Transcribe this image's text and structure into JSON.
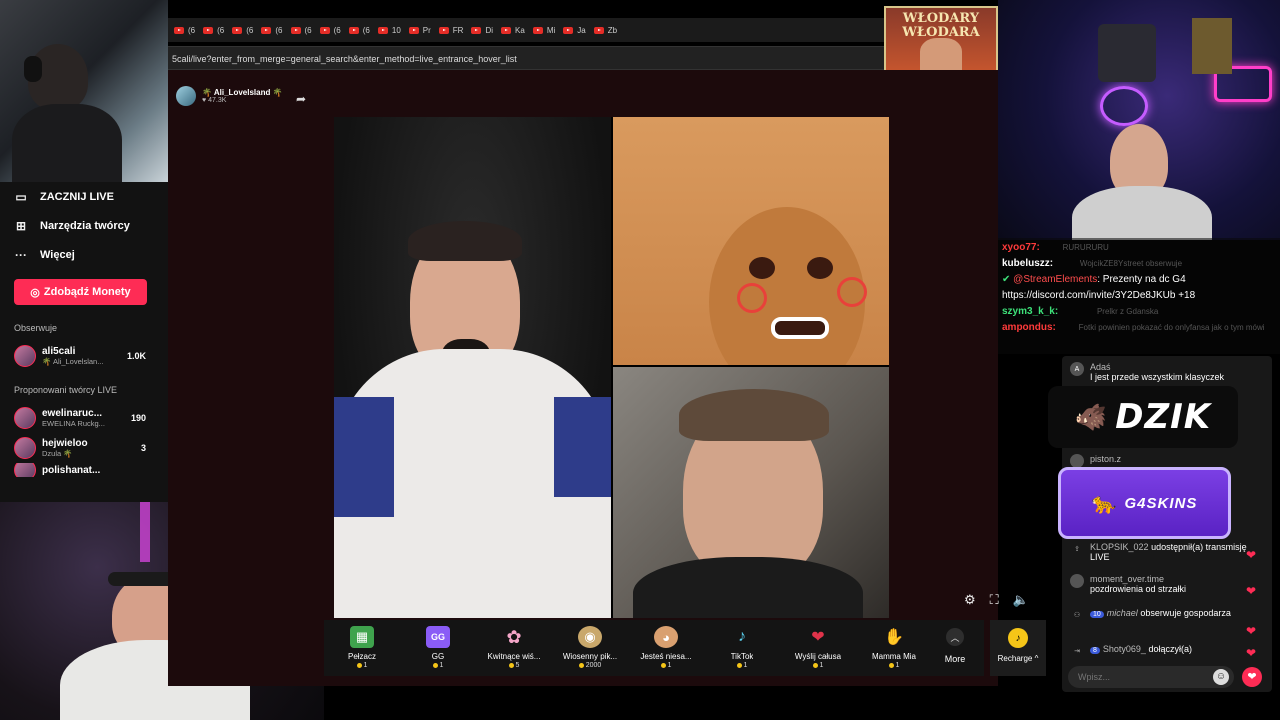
{
  "browser": {
    "tabs": [
      "(6",
      "(6",
      "(6",
      "(6",
      "(6",
      "(6",
      "(6",
      "10",
      "Pr",
      "FR",
      "Di",
      "Ka",
      "Mi",
      "Ja",
      "Zb"
    ],
    "address": "5cali/live?enter_from_merge=general_search&enter_method=live_entrance_hover_list",
    "banner_text": "WŁODARY WŁODARA"
  },
  "sidebar": {
    "menu": [
      {
        "icon": "video-icon",
        "glyph": "▭",
        "label": "ZACZNIJ LIVE"
      },
      {
        "icon": "tools-icon",
        "glyph": "⊞",
        "label": "Narzędzia twórcy"
      },
      {
        "icon": "more-icon",
        "glyph": "···",
        "label": "Więcej"
      }
    ],
    "coins_button": "Zdobądź Monety",
    "following_heading": "Obserwuje",
    "following": [
      {
        "name": "ali5cali",
        "sub": "🌴 Ali_Lovelslan...",
        "count": "1.0K"
      }
    ],
    "suggested_heading": "Proponowani twórcy LIVE",
    "suggested": [
      {
        "name": "ewelinaruc...",
        "sub": "EWELINA Ruckg...",
        "count": "190"
      },
      {
        "name": "hejwieloo",
        "sub": "Dzula 🌴",
        "count": "3"
      },
      {
        "name": "polishanat...",
        "sub": "",
        "count": "..."
      }
    ]
  },
  "live": {
    "host_name": "🌴 Ali_Lovelsland 🌴",
    "host_viewers": "♥ 47.3K"
  },
  "gifts": [
    {
      "name": "Pełzacz",
      "price": "1",
      "color": "#3fa34d",
      "glyph": "▦"
    },
    {
      "name": "GG",
      "price": "1",
      "color": "#8a5cf6",
      "glyph": "GG"
    },
    {
      "name": "Kwitnące wiś...",
      "price": "5",
      "color": "#f4a6c8",
      "glyph": "✿"
    },
    {
      "name": "Wiosenny pik...",
      "price": "2000",
      "color": "#c9a86b",
      "glyph": "◉"
    },
    {
      "name": "Jesteś niesa...",
      "price": "1",
      "color": "#d9a070",
      "glyph": "◕"
    },
    {
      "name": "TikTok",
      "price": "1",
      "color": "#5ad1f0",
      "glyph": "♪"
    },
    {
      "name": "Wyślij całusa",
      "price": "1",
      "color": "#e0334a",
      "glyph": "❤"
    },
    {
      "name": "Mamma Mia",
      "price": "1",
      "color": "#f0b8a0",
      "glyph": "✋"
    }
  ],
  "more_label": "More",
  "recharge_label": "Recharge ^",
  "obs_chat": [
    {
      "user": "xyoo77:",
      "user_color": "#ff3b3b",
      "text": "",
      "ghost": "RURURURU"
    },
    {
      "user": "kubeluszz:",
      "user_color": "#ffffff",
      "text": "",
      "ghost": "WojcikZE8Ystreet  obserwuje"
    },
    {
      "user": "@StreamElements",
      "user_color": "#ff4d4d",
      "text": ": Prezenty na dc G4",
      "ghost": ""
    },
    {
      "user": "",
      "user_color": "#ffffff",
      "text": "https://discord.com/invite/3Y2De8JKUb +18",
      "ghost": ""
    },
    {
      "user": "szym3_k_k:",
      "user_color": "#3ee27a",
      "text": "",
      "ghost": "Prelkr z Gdanska"
    },
    {
      "user": "ampondus:",
      "user_color": "#ff3b3b",
      "text": "",
      "ghost": "Fotki powinien pokazać do onlyfansa jak o tym mówi"
    }
  ],
  "tt_chat": {
    "adas_user": "Adaś",
    "adas_text": "I jest przede wszystkim klasyczek",
    "piston_user": "piston.z",
    "klopsik_user": "KLOPSIK_022",
    "klopsik_text": "udostępnił(a) transmisję LIVE",
    "moment_user": "moment_over.time",
    "moment_text": "pozdrowienia od strzałki",
    "michael_level": "10",
    "michael_user": "michael",
    "michael_text": "obserwuje gospodarza",
    "shoty_level": "8",
    "shoty_user": "Shoty069_",
    "shoty_text": "dołączył(a)",
    "input_placeholder": "Wpisz..."
  },
  "sponsors": {
    "dzik": "DZIK",
    "g4": "G4SKINS"
  }
}
